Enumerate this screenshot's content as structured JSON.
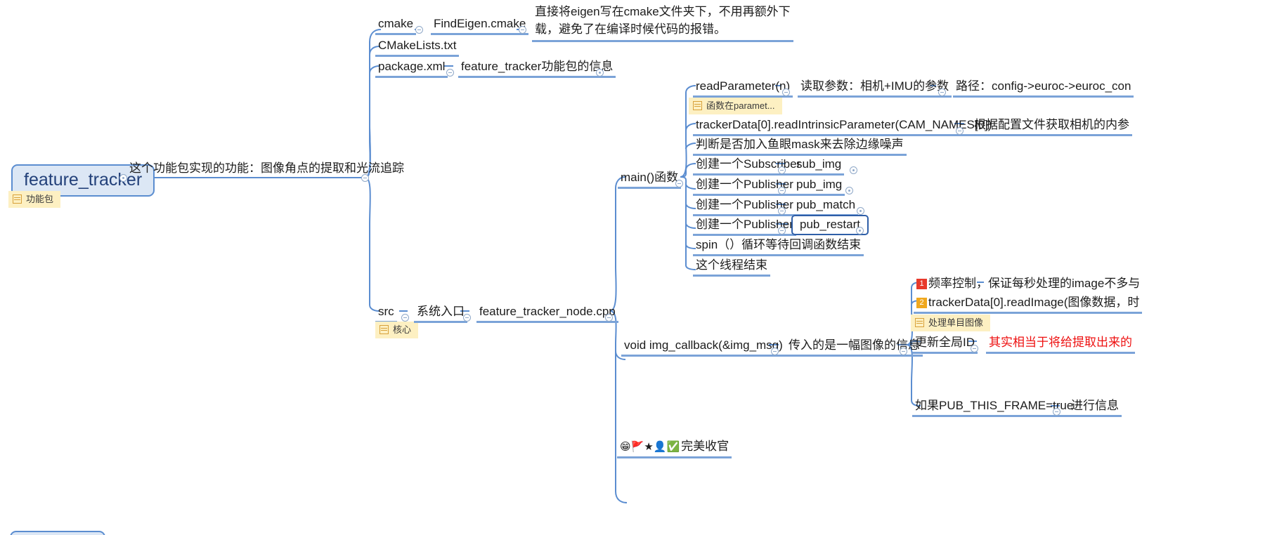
{
  "app": {
    "kind": "mindmap",
    "background": "#ffffff",
    "accent": "#5b8dd0",
    "note_background": "#fdf0c2",
    "selection_color": "#2f5fa8",
    "red_text_color": "#ee1111"
  },
  "root": {
    "label": "feature_tracker",
    "note": "功能包"
  },
  "nodes": {
    "root_summary": "这个功能包实现的功能：图像角点的提取和光流追踪",
    "cmake": "cmake",
    "find_eigen": "FindEigen.cmake",
    "find_eigen_desc": "直接将eigen写在cmake文件夹下，不用再额外下载，避免了在编译时候代码的报错。",
    "cmakelists": "CMakeLists.txt",
    "package_xml": "package.xml",
    "package_xml_desc": "feature_tracker功能包的信息",
    "src": "src",
    "src_note": "核心",
    "src_entry": "系统入口",
    "node_cpp": "feature_tracker_node.cpp",
    "main_fn": "main()函数",
    "read_parameter": "readParameter(n)",
    "read_parameter_desc": "读取参数：相机+IMU的参数",
    "read_parameter_path": "路径：config->euroc->euroc_con",
    "read_parameter_note": "函数在paramet...",
    "read_intrinsic": "trackerData[0].readIntrinsicParameter(CAM_NAMES[0])",
    "read_intrinsic_desc": "根据配置文件获取相机的内参",
    "fisheye_mask": "判断是否加入鱼眼mask来去除边缘噪声",
    "create_subscriber": "创建一个Subscriber",
    "sub_img": "sub_img",
    "create_publisher_1": "创建一个Publisher",
    "pub_img": "pub_img",
    "create_publisher_2": "创建一个Publisher",
    "pub_match": "pub_match",
    "create_publisher_3": "创建一个Publisher",
    "pub_restart": "pub_restart",
    "spin": "spin（）循环等待回调函数结束",
    "thread_end": "这个线程结束",
    "img_callback": "void img_callback(&img_msg)",
    "img_callback_desc": "传入的是一幅图像的信息",
    "freq_control_badge": "1",
    "freq_control": "频率控制，保证每秒处理的image不多与",
    "read_image_badge": "2",
    "read_image": "trackerData[0].readImage(图像数据，时",
    "read_image_note": "处理单目图像",
    "update_id": "更新全局ID",
    "update_id_desc": "其实相当于将给提取出来的",
    "pub_this_frame": "如果PUB_THIS_FRAME=true",
    "pub_this_frame_desc": "进行信息",
    "finish_emojis": "😁🚩★👤✅",
    "finish_label": "完美收官"
  },
  "icons": {
    "collapse_toggle": "collapse-toggle-icon",
    "note_icon": "note-icon",
    "emoji_grin": "grinning-face-icon",
    "emoji_flag": "red-flag-icon",
    "emoji_star": "red-star-icon",
    "emoji_person": "person-icon",
    "emoji_check": "green-check-icon"
  }
}
